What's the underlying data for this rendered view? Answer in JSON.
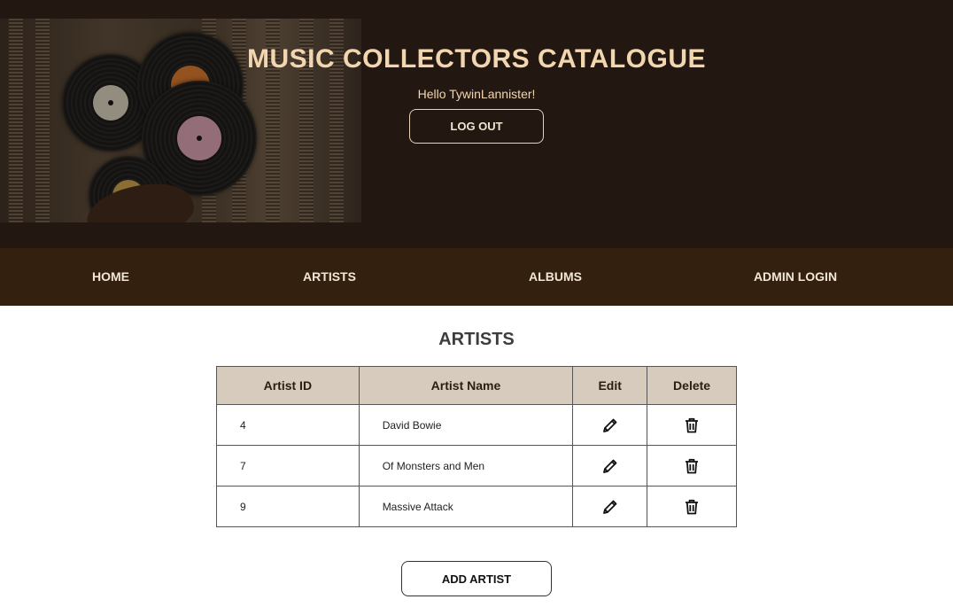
{
  "header": {
    "title": "MUSIC COLLECTORS CATALOGUE",
    "greeting": "Hello TywinLannister!",
    "logout_label": "LOG OUT"
  },
  "nav": {
    "items": [
      {
        "label": "HOME"
      },
      {
        "label": "ARTISTS"
      },
      {
        "label": "ALBUMS"
      },
      {
        "label": "ADMIN LOGIN"
      }
    ]
  },
  "main": {
    "heading": "ARTISTS",
    "table": {
      "columns": [
        "Artist ID",
        "Artist Name",
        "Edit",
        "Delete"
      ],
      "rows": [
        {
          "id": "4",
          "name": "David Bowie"
        },
        {
          "id": "7",
          "name": "Of Monsters and Men"
        },
        {
          "id": "9",
          "name": "Massive Attack"
        }
      ],
      "edit_icon": "pencil-icon",
      "delete_icon": "trash-icon"
    },
    "add_label": "ADD ARTIST"
  },
  "colors": {
    "header_bg": "#221711",
    "nav_bg": "#33200e",
    "title_color": "#f2d6b0",
    "table_header_bg": "#d7cbbd"
  }
}
